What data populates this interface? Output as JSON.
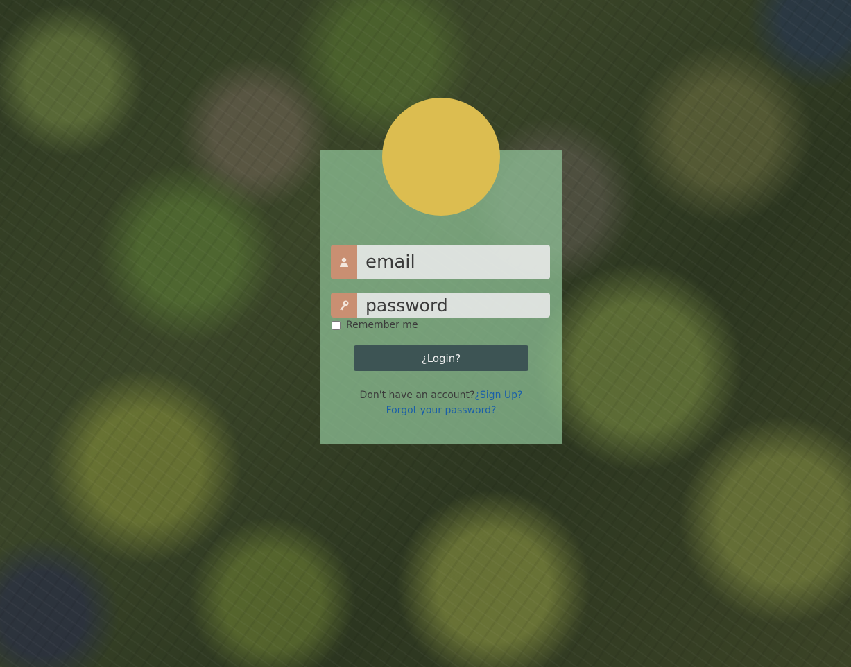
{
  "login": {
    "email_placeholder": "email",
    "password_placeholder": "password",
    "remember_label": "Remember me",
    "login_button": "¿Login?",
    "no_account_text": "Don't have an account?",
    "signup_link": "¿Sign Up?",
    "forgot_link": "Forgot your password?"
  },
  "icons": {
    "email": "user-icon",
    "password": "key-icon"
  },
  "colors": {
    "avatar": "#dcbd50",
    "icon_prefix": "#c98f72",
    "card": "#96cda0",
    "button": "#3d5454",
    "link": "#1a5fa8"
  }
}
